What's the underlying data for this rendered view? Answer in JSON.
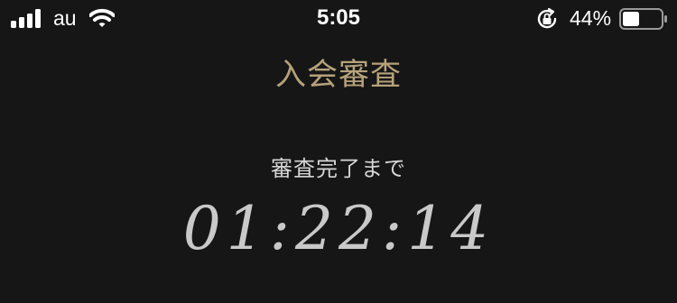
{
  "status_bar": {
    "carrier": "au",
    "time": "5:05",
    "battery_percent": "44%",
    "battery_level": 0.44,
    "signal_bars": 4,
    "icons": [
      "signal-icon",
      "wifi-icon",
      "rotation-lock-icon",
      "battery-icon"
    ]
  },
  "main": {
    "title": "入会審査",
    "countdown_label": "審査完了まで",
    "countdown_time": "01:22:14"
  },
  "colors": {
    "background": "#161616",
    "title": "#b6a27b",
    "label": "#d6d6d6",
    "timer": "#c9c9c9"
  }
}
